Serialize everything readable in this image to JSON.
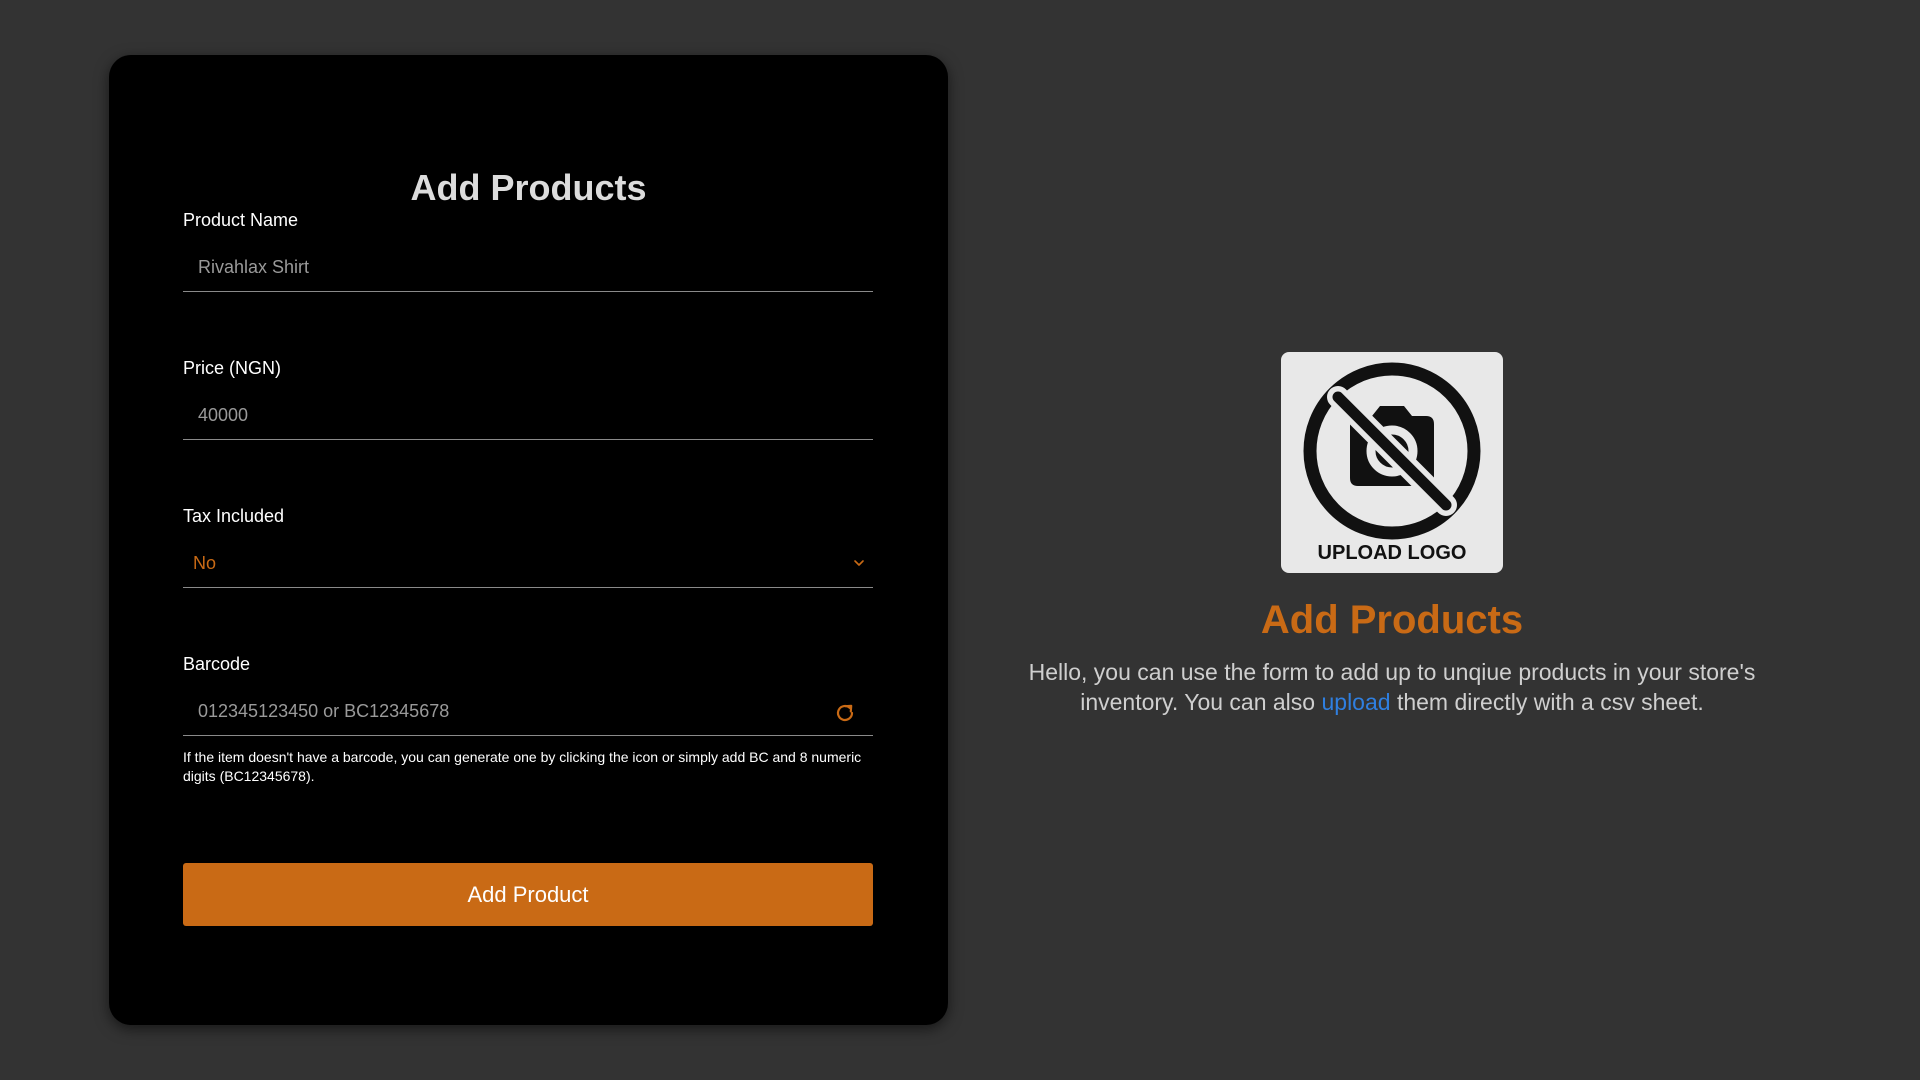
{
  "form": {
    "title": "Add Products",
    "product_name": {
      "label": "Product Name",
      "value": "Rivahlax Shirt"
    },
    "price": {
      "label": "Price (NGN)",
      "value": "40000"
    },
    "tax": {
      "label": "Tax Included",
      "selected": "No"
    },
    "barcode": {
      "label": "Barcode",
      "placeholder": "012345123450 or BC12345678",
      "helper": "If the item doesn't have a barcode, you can generate one by clicking the icon or simply add BC and 8 numeric digits (BC12345678)."
    },
    "submit_label": "Add Product"
  },
  "info": {
    "logo_text": "UPLOAD LOGO",
    "title": "Add Products",
    "text_before_link": "Hello, you can use the form to add up to unqiue products in your store's inventory. You can also ",
    "link_text": "upload",
    "text_after_link": " them directly with a csv sheet."
  },
  "colors": {
    "accent": "#c96a15",
    "link": "#2f7fe0",
    "card_bg": "#000000",
    "page_bg": "#333333"
  },
  "icons": {
    "tax_select": "chevron-down-icon",
    "barcode_generate": "refresh-icon",
    "logo_placeholder": "no-camera-icon"
  }
}
